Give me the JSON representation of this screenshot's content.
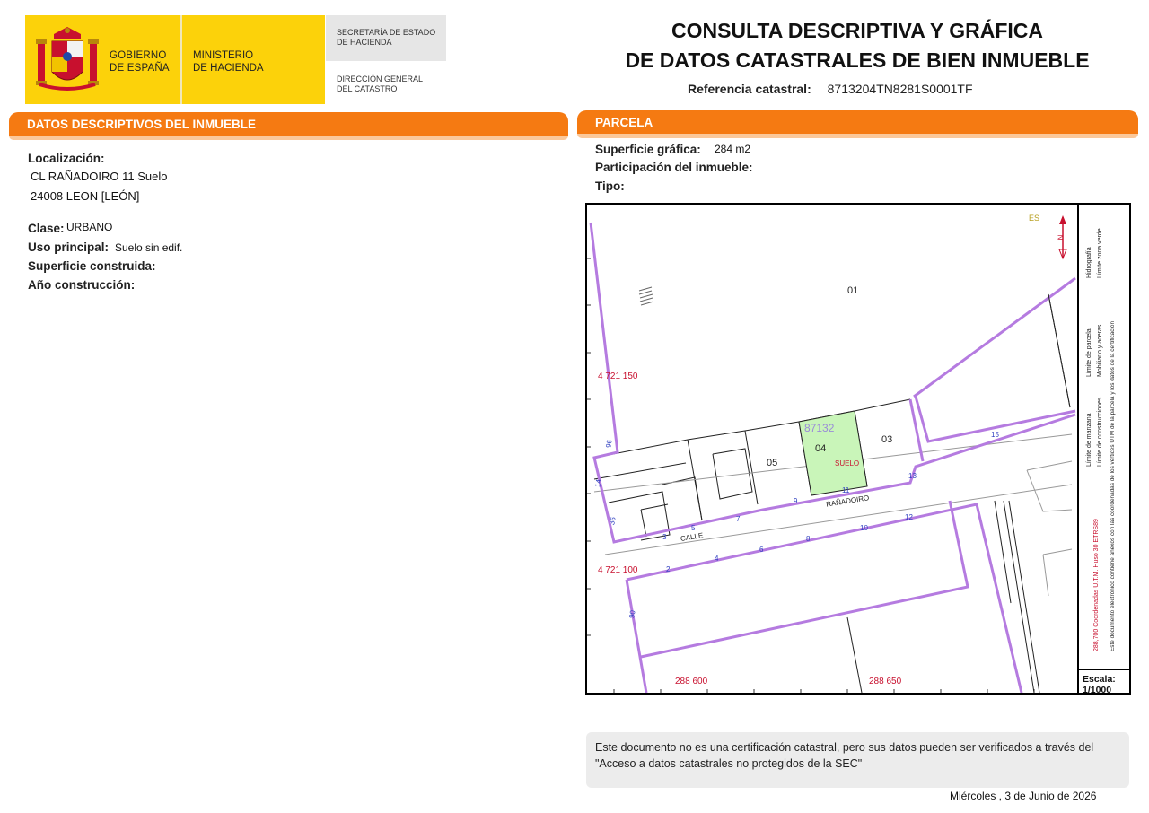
{
  "header": {
    "gov_line1": "GOBIERNO",
    "gov_line2": "DE ESPAÑA",
    "min_line1": "MINISTERIO",
    "min_line2": "DE HACIENDA",
    "sec_line1": "SECRETARÍA DE ESTADO",
    "sec_line2": "DE HACIENDA",
    "dir_line1": "DIRECCIÓN GENERAL",
    "dir_line2": "DEL CATASTRO",
    "brand_yellow": "#fcd20a",
    "crest_icon": "coat-of-arms-icon"
  },
  "title": {
    "line1": "CONSULTA DESCRIPTIVA Y GRÁFICA",
    "line2": "DE DATOS CATASTRALES DE BIEN INMUEBLE",
    "ref_label": "Referencia catastral:",
    "ref_value": "8713204TN8281S0001TF"
  },
  "descriptivos": {
    "header": "DATOS DESCRIPTIVOS DEL INMUEBLE",
    "localizacion_label": "Localización:",
    "address_line1": "CL RAÑADOIRO 11 Suelo",
    "address_line2": "24008 LEON [LEÓN]",
    "clase_label": "Clase:",
    "clase_value": "URBANO",
    "uso_label": "Uso principal:",
    "uso_value": "Suelo sin edif.",
    "superficie_label": "Superficie construida:",
    "anio_label": "Año construcción:"
  },
  "parcela": {
    "header": "PARCELA",
    "superficie_label": "Superficie gráfica:",
    "superficie_value": "284 m2",
    "participacion_label": "Participación del inmueble:",
    "tipo_label": "Tipo:"
  },
  "map": {
    "coord_y1": "4 721 150",
    "coord_y2": "4 721 100",
    "coord_x1": "288 600",
    "coord_x2": "288 650",
    "parcel_ref": "87132",
    "parcel_labels": [
      "01",
      "03",
      "04",
      "05"
    ],
    "suelo_label": "SUELO",
    "street1": "RAÑADOIRO",
    "street2": "CALLE",
    "numbers": [
      "96",
      "14",
      "36",
      "3",
      "5",
      "7",
      "9",
      "11",
      "13",
      "15",
      "2",
      "4",
      "6",
      "8",
      "10",
      "12",
      "90"
    ],
    "north_label": "N",
    "corner_code": "ES",
    "scale_label": "Escala:",
    "scale_value": "1/1000",
    "legend_1a": "Límite de manzana",
    "legend_1b": "Límite de construcciones",
    "legend_2a": "Límite de parcela",
    "legend_2b": "Mobiliario y aceras",
    "legend_3a": "Hidrografía",
    "legend_3b": "Límite zona verde",
    "legend_4": "Este documento electrónico contiene anexos con las coordenadas de los vértices UTM de la parcela y los datos de la certificación",
    "legend_red": "288,700 Coordenadas U.T.M. Huso 30 ETRS89",
    "highlight_color": "#c9f5b9",
    "block_color": "#b57be0"
  },
  "note": {
    "text": "Este documento no es una certificación catastral, pero sus datos pueden ser verificados a través del \"Acceso a datos catastrales no protegidos de la SEC\""
  },
  "footer": {
    "date": "Miércoles , 3 de Junio de 2026"
  }
}
